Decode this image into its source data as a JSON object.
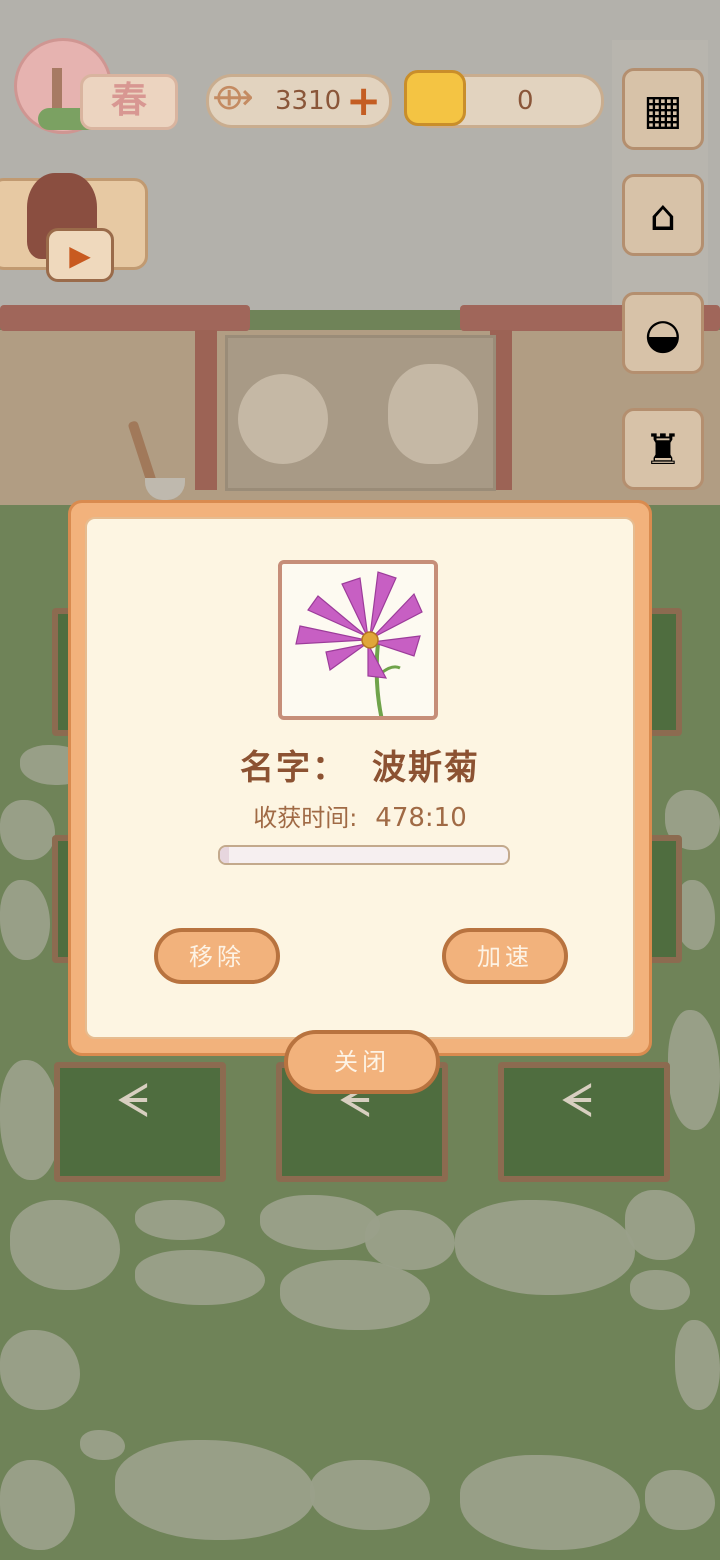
{
  "hud": {
    "season_label": "春",
    "fish_count": "3310",
    "fish_icon": "fish-bone-icon",
    "plus_icon": "plus-icon",
    "cheese_count": "0",
    "cheese_icon": "cheese-icon",
    "side_buttons": [
      {
        "name": "window-button",
        "icon": "window-icon"
      },
      {
        "name": "shop-stall-button",
        "icon": "stall-icon"
      },
      {
        "name": "basket-button",
        "icon": "basket-icon"
      },
      {
        "name": "trophy-button",
        "icon": "trophy-icon"
      }
    ],
    "video_play_icon": "play-icon"
  },
  "dialog": {
    "image": "cosmos-flower",
    "name_label": "名字：",
    "name_value": "波斯菊",
    "harvest_label": "收获时间:",
    "harvest_value": "478:10",
    "progress": 0.03,
    "remove_label": "移除",
    "speedup_label": "加速",
    "close_label": "关闭"
  },
  "colors": {
    "panel_bg": "#fdf5e2",
    "panel_border": "#f2b27c",
    "button_fill": "#f2b27c",
    "button_text": "#fdf3e5",
    "title_text": "#8c5232",
    "accent": "#c45d22"
  }
}
